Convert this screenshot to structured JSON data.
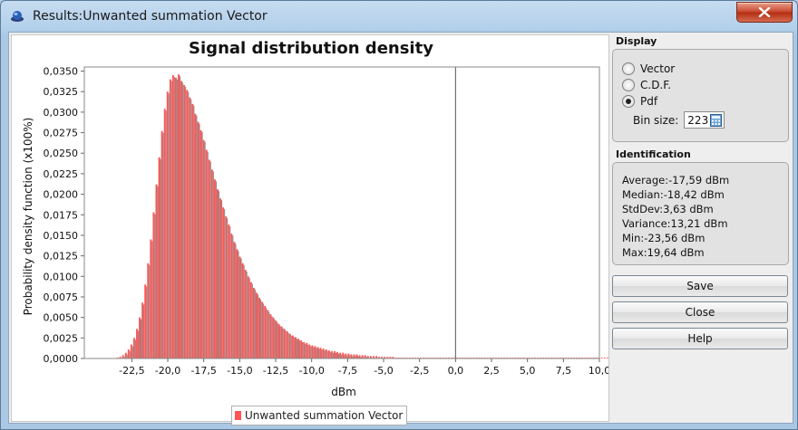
{
  "window": {
    "title": "Results:Unwanted summation Vector"
  },
  "chart_data": {
    "type": "bar",
    "title": "Signal distribution density",
    "xlabel": "dBm",
    "ylabel": "Probability density function (x100%)",
    "xlim": [
      -25.8,
      10.0
    ],
    "ylim": [
      0.0,
      0.0355
    ],
    "xticks": [
      "-22,5",
      "-20,0",
      "-17,5",
      "-15,0",
      "-12,5",
      "-10,0",
      "-7,5",
      "-5,0",
      "-2,5",
      "0,0",
      "2,5",
      "5,0",
      "7,5",
      "10,0"
    ],
    "xtick_values": [
      -22.5,
      -20,
      -17.5,
      -15,
      -12.5,
      -10,
      -7.5,
      -5,
      -2.5,
      0,
      2.5,
      5,
      7.5,
      10
    ],
    "yticks": [
      "0,0000",
      "0,0025",
      "0,0050",
      "0,0075",
      "0,0100",
      "0,0125",
      "0,0150",
      "0,0175",
      "0,0200",
      "0,0225",
      "0,0250",
      "0,0275",
      "0,0300",
      "0,0325",
      "0,0350"
    ],
    "ytick_values": [
      0,
      0.0025,
      0.005,
      0.0075,
      0.01,
      0.0125,
      0.015,
      0.0175,
      0.02,
      0.0225,
      0.025,
      0.0275,
      0.03,
      0.0325,
      0.035
    ],
    "vertical_line_at": 0.0,
    "grid": false,
    "series": [
      {
        "name": "Unwanted summation Vector",
        "color": "#ff5555",
        "bin_start": -23.56,
        "bin_width": 0.1935,
        "values": [
          0.0001,
          0.0002,
          0.0004,
          0.0007,
          0.0011,
          0.0017,
          0.0025,
          0.0036,
          0.005,
          0.0068,
          0.009,
          0.0116,
          0.0145,
          0.0178,
          0.0212,
          0.0245,
          0.0277,
          0.0304,
          0.0325,
          0.034,
          0.0345,
          0.0342,
          0.0346,
          0.0338,
          0.0333,
          0.0327,
          0.0318,
          0.031,
          0.0298,
          0.0288,
          0.0278,
          0.0266,
          0.0254,
          0.0242,
          0.023,
          0.0218,
          0.0206,
          0.0195,
          0.0184,
          0.0173,
          0.0163,
          0.0152,
          0.0142,
          0.0133,
          0.0124,
          0.0116,
          0.0108,
          0.01,
          0.0093,
          0.0086,
          0.008,
          0.0074,
          0.0069,
          0.0064,
          0.0059,
          0.0054,
          0.005,
          0.0046,
          0.0042,
          0.0039,
          0.0036,
          0.0033,
          0.003,
          0.0028,
          0.0026,
          0.0024,
          0.0022,
          0.002,
          0.0019,
          0.0017,
          0.0016,
          0.0015,
          0.0014,
          0.0013,
          0.0012,
          0.0011,
          0.001,
          0.0009,
          0.0009,
          0.0008,
          0.0007,
          0.0007,
          0.0006,
          0.0006,
          0.0005,
          0.0005,
          0.0005,
          0.0004,
          0.0004,
          0.0004,
          0.0003,
          0.0003,
          0.0003,
          0.0003,
          0.0002,
          0.0002,
          0.0002,
          0.0002,
          0.0002,
          0.0002,
          0.0001,
          0.0001,
          0.0001,
          0.0001,
          0.0001,
          0.0001,
          0.0001,
          0.0001,
          0.0001,
          0.0001,
          0.0001,
          0.0001,
          0.0001,
          0.0001,
          0.0001,
          0.0001,
          0.0001,
          0.0001,
          0.0001,
          0.0001,
          0.0001,
          0.0001,
          0.0001,
          0.0001,
          0.0001,
          0.0001,
          0.0001,
          0.0001,
          0.0001,
          0.0001,
          0.0001,
          0.0001,
          0.0001,
          0.0001,
          0.0001,
          0.0001,
          0.0001,
          0.0001,
          0.0001,
          0.0001,
          0.0001,
          0.0001,
          0.0001,
          0.0001,
          0.0001,
          0.0001,
          0.0001,
          0.0001,
          0.0001,
          0.0001,
          0.0001,
          0.0001,
          0.0001,
          0.0001,
          0.0001,
          0.0001,
          0.0001,
          0.0001,
          0.0001,
          0.0001,
          0.0001,
          0.0001,
          0.0001,
          0.0001,
          0.0001,
          0.0001,
          0.0001,
          0.0001,
          0.0001,
          0.0001,
          0.0001,
          0.0001,
          0.0001,
          0.0001,
          0.0001,
          0.0001,
          0.0001,
          0.0001
        ]
      }
    ]
  },
  "display": {
    "title": "Display",
    "options": [
      {
        "label": "Vector",
        "checked": false
      },
      {
        "label": "C.D.F.",
        "checked": false
      },
      {
        "label": "Pdf",
        "checked": true
      }
    ],
    "bin_size_label": "Bin size:",
    "bin_size_value": "223"
  },
  "identification": {
    "title": "Identification",
    "average": "Average:-17,59 dBm",
    "median": "Median:-18,42 dBm",
    "stddev": "StdDev:3,63 dBm",
    "variance": "Variance:13,21 dBm",
    "min": "Min:-23,56 dBm",
    "max": "Max:19,64 dBm"
  },
  "buttons": {
    "save": "Save",
    "close": "Close",
    "help": "Help"
  }
}
